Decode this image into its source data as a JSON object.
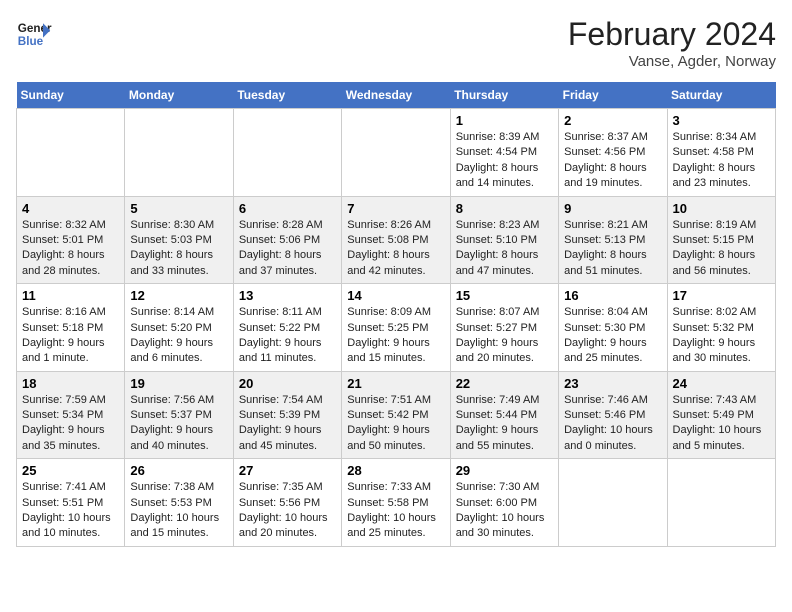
{
  "header": {
    "logo_line1": "General",
    "logo_line2": "Blue",
    "main_title": "February 2024",
    "subtitle": "Vanse, Agder, Norway"
  },
  "days_of_week": [
    "Sunday",
    "Monday",
    "Tuesday",
    "Wednesday",
    "Thursday",
    "Friday",
    "Saturday"
  ],
  "weeks": [
    [
      {
        "num": "",
        "info": ""
      },
      {
        "num": "",
        "info": ""
      },
      {
        "num": "",
        "info": ""
      },
      {
        "num": "",
        "info": ""
      },
      {
        "num": "1",
        "info": "Sunrise: 8:39 AM\nSunset: 4:54 PM\nDaylight: 8 hours\nand 14 minutes."
      },
      {
        "num": "2",
        "info": "Sunrise: 8:37 AM\nSunset: 4:56 PM\nDaylight: 8 hours\nand 19 minutes."
      },
      {
        "num": "3",
        "info": "Sunrise: 8:34 AM\nSunset: 4:58 PM\nDaylight: 8 hours\nand 23 minutes."
      }
    ],
    [
      {
        "num": "4",
        "info": "Sunrise: 8:32 AM\nSunset: 5:01 PM\nDaylight: 8 hours\nand 28 minutes."
      },
      {
        "num": "5",
        "info": "Sunrise: 8:30 AM\nSunset: 5:03 PM\nDaylight: 8 hours\nand 33 minutes."
      },
      {
        "num": "6",
        "info": "Sunrise: 8:28 AM\nSunset: 5:06 PM\nDaylight: 8 hours\nand 37 minutes."
      },
      {
        "num": "7",
        "info": "Sunrise: 8:26 AM\nSunset: 5:08 PM\nDaylight: 8 hours\nand 42 minutes."
      },
      {
        "num": "8",
        "info": "Sunrise: 8:23 AM\nSunset: 5:10 PM\nDaylight: 8 hours\nand 47 minutes."
      },
      {
        "num": "9",
        "info": "Sunrise: 8:21 AM\nSunset: 5:13 PM\nDaylight: 8 hours\nand 51 minutes."
      },
      {
        "num": "10",
        "info": "Sunrise: 8:19 AM\nSunset: 5:15 PM\nDaylight: 8 hours\nand 56 minutes."
      }
    ],
    [
      {
        "num": "11",
        "info": "Sunrise: 8:16 AM\nSunset: 5:18 PM\nDaylight: 9 hours\nand 1 minute."
      },
      {
        "num": "12",
        "info": "Sunrise: 8:14 AM\nSunset: 5:20 PM\nDaylight: 9 hours\nand 6 minutes."
      },
      {
        "num": "13",
        "info": "Sunrise: 8:11 AM\nSunset: 5:22 PM\nDaylight: 9 hours\nand 11 minutes."
      },
      {
        "num": "14",
        "info": "Sunrise: 8:09 AM\nSunset: 5:25 PM\nDaylight: 9 hours\nand 15 minutes."
      },
      {
        "num": "15",
        "info": "Sunrise: 8:07 AM\nSunset: 5:27 PM\nDaylight: 9 hours\nand 20 minutes."
      },
      {
        "num": "16",
        "info": "Sunrise: 8:04 AM\nSunset: 5:30 PM\nDaylight: 9 hours\nand 25 minutes."
      },
      {
        "num": "17",
        "info": "Sunrise: 8:02 AM\nSunset: 5:32 PM\nDaylight: 9 hours\nand 30 minutes."
      }
    ],
    [
      {
        "num": "18",
        "info": "Sunrise: 7:59 AM\nSunset: 5:34 PM\nDaylight: 9 hours\nand 35 minutes."
      },
      {
        "num": "19",
        "info": "Sunrise: 7:56 AM\nSunset: 5:37 PM\nDaylight: 9 hours\nand 40 minutes."
      },
      {
        "num": "20",
        "info": "Sunrise: 7:54 AM\nSunset: 5:39 PM\nDaylight: 9 hours\nand 45 minutes."
      },
      {
        "num": "21",
        "info": "Sunrise: 7:51 AM\nSunset: 5:42 PM\nDaylight: 9 hours\nand 50 minutes."
      },
      {
        "num": "22",
        "info": "Sunrise: 7:49 AM\nSunset: 5:44 PM\nDaylight: 9 hours\nand 55 minutes."
      },
      {
        "num": "23",
        "info": "Sunrise: 7:46 AM\nSunset: 5:46 PM\nDaylight: 10 hours\nand 0 minutes."
      },
      {
        "num": "24",
        "info": "Sunrise: 7:43 AM\nSunset: 5:49 PM\nDaylight: 10 hours\nand 5 minutes."
      }
    ],
    [
      {
        "num": "25",
        "info": "Sunrise: 7:41 AM\nSunset: 5:51 PM\nDaylight: 10 hours\nand 10 minutes."
      },
      {
        "num": "26",
        "info": "Sunrise: 7:38 AM\nSunset: 5:53 PM\nDaylight: 10 hours\nand 15 minutes."
      },
      {
        "num": "27",
        "info": "Sunrise: 7:35 AM\nSunset: 5:56 PM\nDaylight: 10 hours\nand 20 minutes."
      },
      {
        "num": "28",
        "info": "Sunrise: 7:33 AM\nSunset: 5:58 PM\nDaylight: 10 hours\nand 25 minutes."
      },
      {
        "num": "29",
        "info": "Sunrise: 7:30 AM\nSunset: 6:00 PM\nDaylight: 10 hours\nand 30 minutes."
      },
      {
        "num": "",
        "info": ""
      },
      {
        "num": "",
        "info": ""
      }
    ]
  ]
}
